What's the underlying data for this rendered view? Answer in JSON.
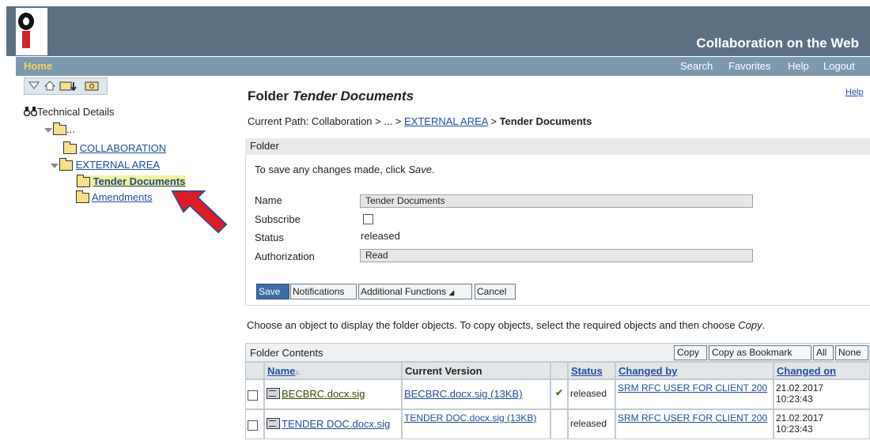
{
  "header": {
    "app_title": "Collaboration on the Web",
    "home_label": "Home",
    "nav_links": [
      "Search",
      "Favorites",
      "Help",
      "Logout"
    ]
  },
  "tree": {
    "root_label": "Technical Details",
    "ellipsis_label": "...",
    "items": [
      {
        "label": "COLLABORATION"
      },
      {
        "label": "EXTERNAL AREA"
      },
      {
        "label": "Tender Documents"
      },
      {
        "label": "Amendments"
      }
    ]
  },
  "main": {
    "title_prefix": "Folder",
    "title_name": "Tender Documents",
    "help": "Help",
    "path_prefix": "Current Path:  Collaboration > ... > ",
    "path_link": "EXTERNAL AREA",
    "path_sep": " > ",
    "path_current": "Tender Documents",
    "folder_section": "Folder",
    "save_hint_1": "To save any changes made, click ",
    "save_hint_em": "Save",
    "save_hint_2": ".",
    "form": {
      "name_label": "Name",
      "name_value": "Tender Documents",
      "subscribe_label": "Subscribe",
      "status_label": "Status",
      "status_value": "released",
      "authorization_label": "Authorization",
      "authorization_value": "Read"
    },
    "buttons": {
      "save": "Save",
      "notifications": "Notifications",
      "additional": "Additional Functions",
      "cancel": "Cancel"
    },
    "choose_text_1": "Choose an object to display the folder objects. To copy objects, select the required objects and then choose ",
    "choose_text_em": "Copy",
    "choose_text_2": "."
  },
  "contents": {
    "title": "Folder Contents",
    "buttons": {
      "copy": "Copy",
      "bookmark": "Copy as Bookmark",
      "all": "All",
      "none": "None"
    },
    "columns": {
      "name": "Name",
      "version": "Current Version",
      "status": "Status",
      "changed_by": "Changed by",
      "changed_on": "Changed on"
    },
    "rows": [
      {
        "name": "BECBRC.docx.sig",
        "version": "BECBRC.docx.sig (13KB)",
        "status": "released",
        "changed_by": "SRM RFC USER FOR CLIENT 200",
        "date": "21.02.2017",
        "time": "10:23:43"
      },
      {
        "name": "TENDER DOC.docx.sig",
        "version": "TENDER DOC.docx.sig (13KB)",
        "status": "released",
        "changed_by": "SRM RFC USER FOR CLIENT 200",
        "date": "21.02.2017",
        "time": "10:23:43"
      }
    ]
  }
}
